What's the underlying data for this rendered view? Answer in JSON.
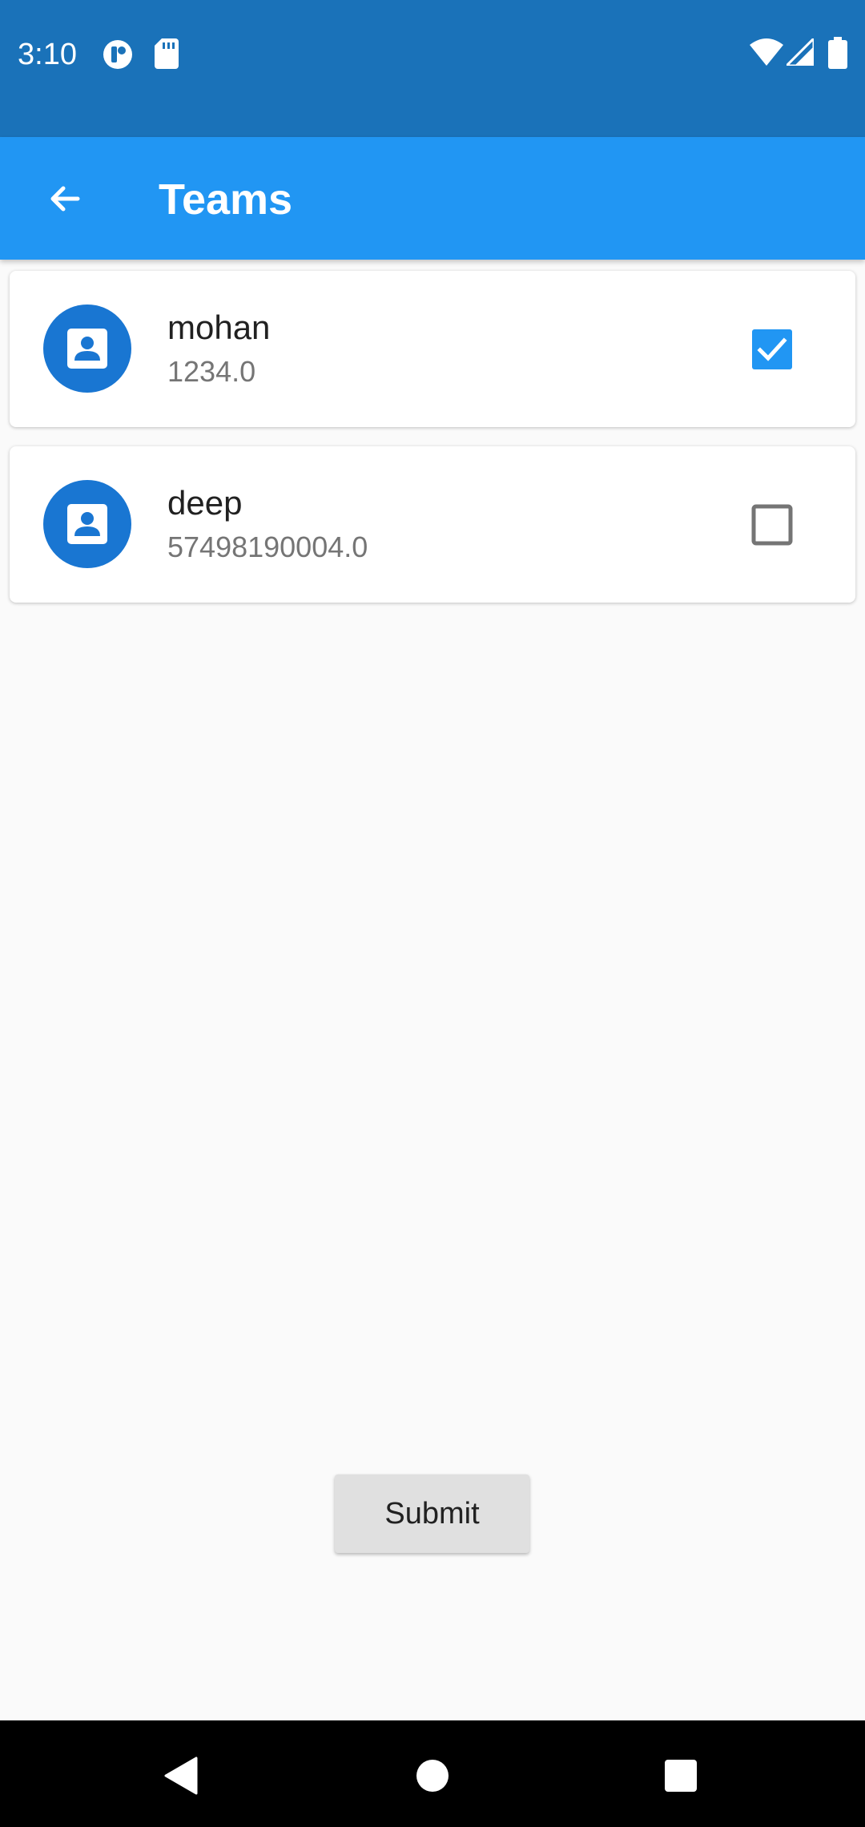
{
  "status_bar": {
    "time": "3:10",
    "left_icons": [
      "notification-app-icon",
      "sd-card-icon"
    ],
    "right_icons": [
      "wifi-icon",
      "cell-signal-icon",
      "battery-icon"
    ]
  },
  "app_bar": {
    "title": "Teams",
    "back_icon": "arrow-back-icon"
  },
  "teams": [
    {
      "name": "mohan",
      "number": "1234.0",
      "checked": true
    },
    {
      "name": "deep",
      "number": "57498190004.0",
      "checked": false
    }
  ],
  "submit": {
    "label": "Submit"
  },
  "nav_bar": {
    "buttons": [
      "back-triangle",
      "home-circle",
      "recents-square"
    ]
  },
  "colors": {
    "status_bar": "#1a72b9",
    "app_bar": "#2196f3",
    "avatar": "#1976d2",
    "checkbox_checked": "#2196f3",
    "checkbox_unchecked": "#757575",
    "background": "#fafafa"
  }
}
